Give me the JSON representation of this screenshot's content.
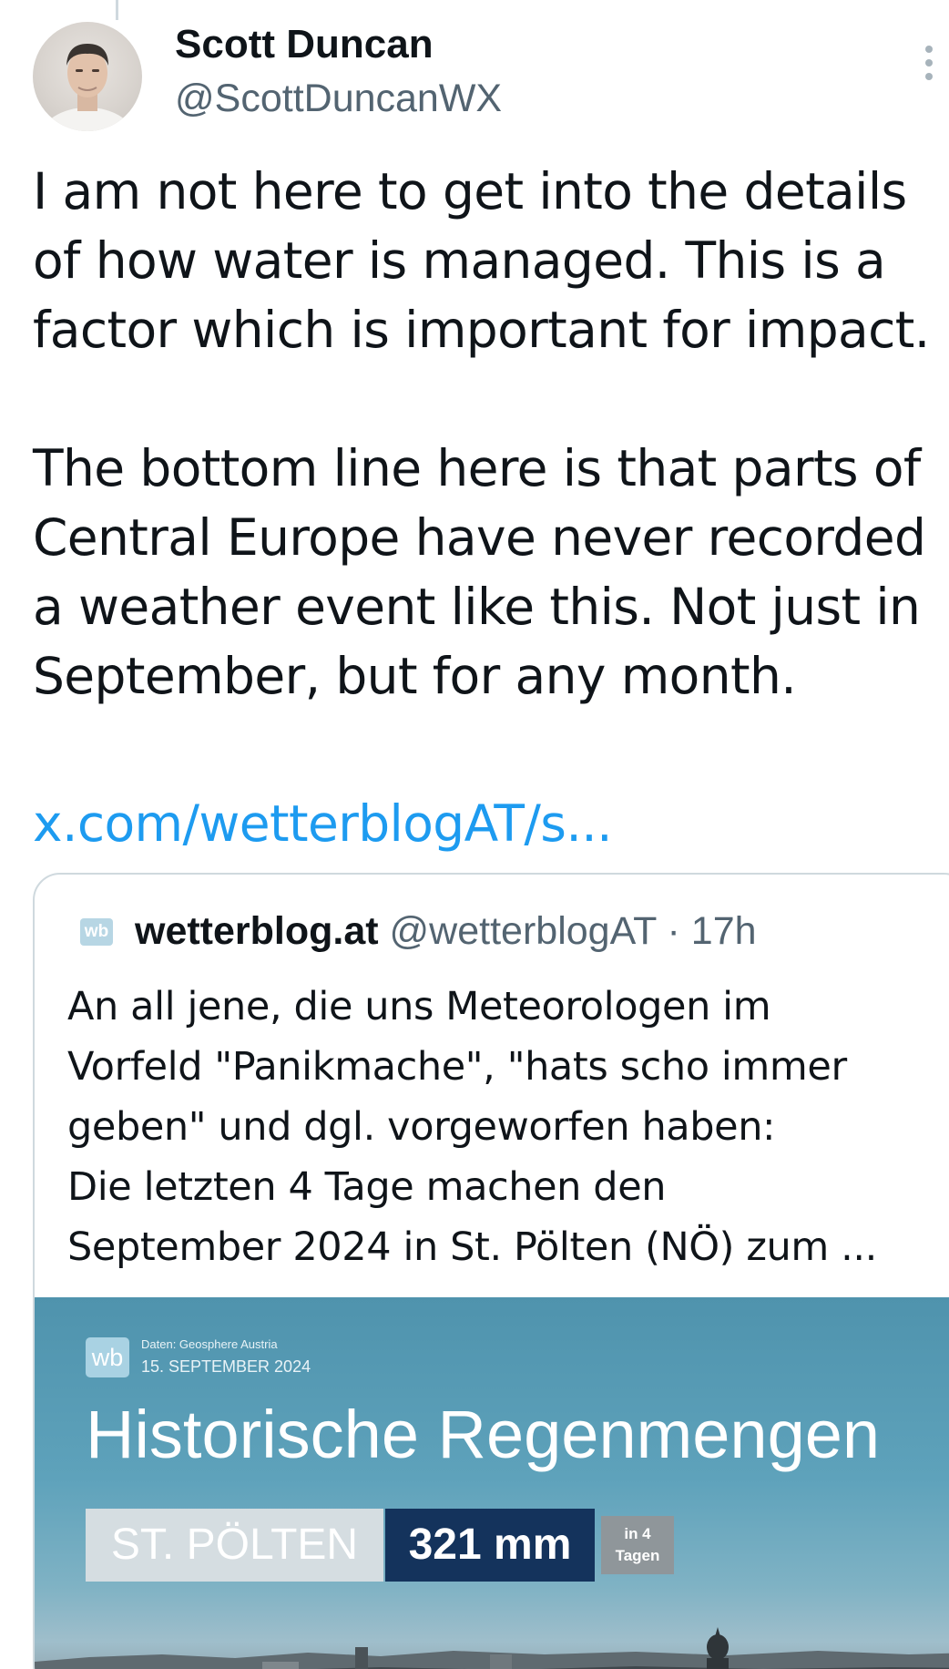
{
  "tweet": {
    "author": {
      "name": "Scott Duncan",
      "handle": "@ScottDuncanWX"
    },
    "text_lines_para1": [
      "I am not here to get into the details",
      "of how water is managed. This is a",
      "factor which is important for impact."
    ],
    "text_lines_para2": [
      "The bottom line here is that parts of",
      "Central Europe have never recorded",
      "a weather event like this. Not just in",
      "September, but for any month."
    ],
    "link": "x.com/wetterblogAT/s..."
  },
  "quoted_tweet": {
    "avatar_text": "wb",
    "name": "wetterblog.at",
    "handle": "@wetterblogAT",
    "separator": "·",
    "time": "17h",
    "text_lines": [
      "An all jene, die uns Meteorologen im",
      "Vorfeld \"Panikmache\", \"hats scho immer",
      "geben\" und dgl. vorgeworfen haben:",
      "Die letzten 4 Tage machen den",
      "September 2024 in St. Pölten (NÖ) zum ..."
    ],
    "media": {
      "logo_text": "wb",
      "source": "Daten: Geosphere Austria",
      "date": "15. SEPTEMBER 2024",
      "title": "Historische Regenmengen",
      "city": "ST. PÖLTEN",
      "amount": "321 mm",
      "period_line1": "in 4",
      "period_line2": "Tagen"
    }
  },
  "icons": {
    "more": "more-vertical-icon"
  },
  "colors": {
    "link": "#1d9bf0",
    "secondary_text": "#536471",
    "border": "#cfd9de",
    "amount_bg": "#14335c"
  }
}
